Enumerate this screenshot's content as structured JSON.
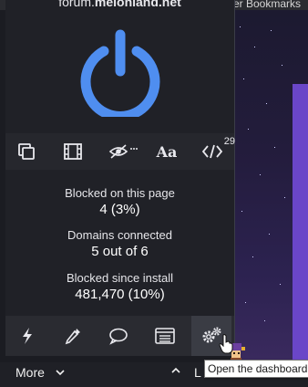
{
  "browser": {
    "bookmarks_text": "er Bookmarks"
  },
  "popup": {
    "hostname_prefix": "forum.",
    "hostname_domain": "melonland.net",
    "accent_color": "#4f8ef0",
    "tools": [
      {
        "name": "element-picker-icon"
      },
      {
        "name": "media-icon"
      },
      {
        "name": "cosmetic-filter-icon"
      },
      {
        "name": "fonts-icon",
        "label": "Aa"
      },
      {
        "name": "scripts-icon",
        "badge": "29"
      }
    ],
    "stats": [
      {
        "label": "Blocked on this page",
        "value": "4 (3%)"
      },
      {
        "label": "Domains connected",
        "value": "5 out of 6"
      },
      {
        "label": "Blocked since install",
        "value": "481,470 (10%)"
      }
    ],
    "actions": [
      {
        "name": "lightning-icon"
      },
      {
        "name": "eyedropper-icon"
      },
      {
        "name": "chat-bubble-icon"
      },
      {
        "name": "list-icon"
      },
      {
        "name": "gears-icon",
        "active": true
      }
    ],
    "more_label": "More",
    "less_label": "L",
    "tooltip": "Open the dashboard"
  }
}
